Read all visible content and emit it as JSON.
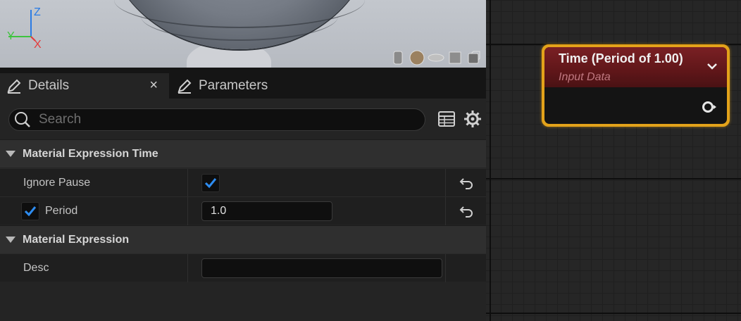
{
  "viewport": {
    "gizmo": {
      "z": "Z",
      "y": "Y",
      "x": "X"
    },
    "preview_shapes": [
      "cylinder-icon",
      "sphere-icon",
      "plane-icon",
      "cube-icon",
      "teapot-icon"
    ]
  },
  "tabs": {
    "details": "Details",
    "close": "×",
    "parameters": "Parameters"
  },
  "search": {
    "placeholder": "Search"
  },
  "categories": [
    {
      "label": "Material Expression Time"
    },
    {
      "label": "Material Expression"
    }
  ],
  "properties": {
    "ignore_pause": {
      "label": "Ignore Pause",
      "checked": true
    },
    "period": {
      "label": "Period",
      "enabled": true,
      "value": "1.0"
    },
    "desc": {
      "label": "Desc",
      "value": ""
    }
  },
  "node": {
    "title": "Time (Period of 1.00)",
    "subtitle": "Input Data",
    "accent": "#e3a21a",
    "header_color": "#7a2024"
  }
}
